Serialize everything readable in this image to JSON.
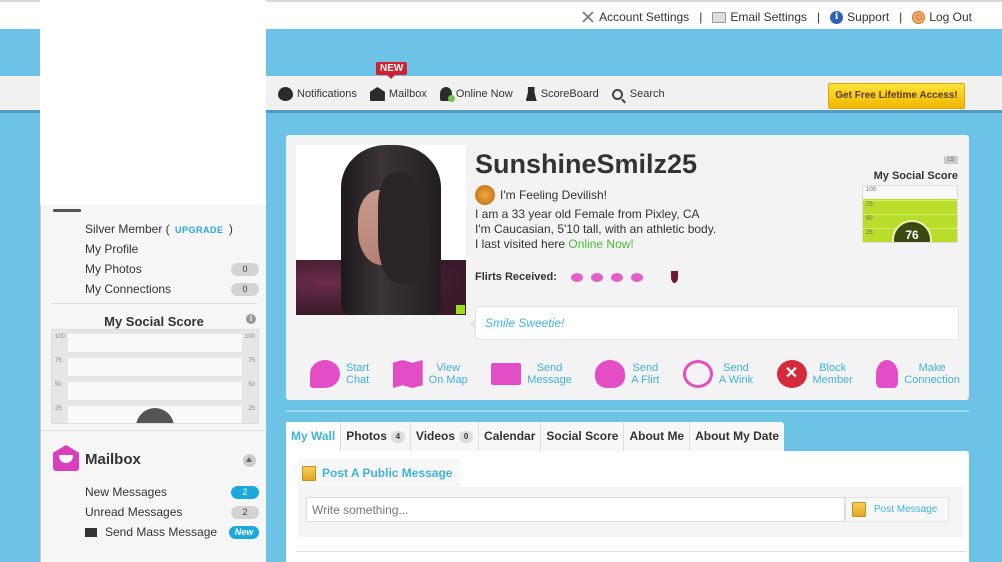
{
  "top_links": {
    "account_settings": "Account Settings",
    "email_settings": "Email Settings",
    "support": "Support",
    "log_out": "Log Out",
    "separator": "|"
  },
  "nav": {
    "new_badge": "NEW",
    "items": [
      {
        "label": "Notifications",
        "icon": "speech-bubble-icon"
      },
      {
        "label": "Mailbox",
        "icon": "envelope-icon"
      },
      {
        "label": "Online Now",
        "icon": "person-online-icon"
      },
      {
        "label": "ScoreBoard",
        "icon": "trophy-icon"
      },
      {
        "label": "Search",
        "icon": "search-icon"
      }
    ],
    "cta": "Get Free Lifetime Access!"
  },
  "sidebar": {
    "membership": "Silver Member (",
    "upgrade": "UPGRADE",
    "membership_close": ")",
    "links": [
      {
        "label": "My Profile"
      },
      {
        "label": "My Photos",
        "count": "0"
      },
      {
        "label": "My Connections",
        "count": "0"
      }
    ],
    "social_score": {
      "title": "My Social Score",
      "ticks": [
        "100",
        "75",
        "50",
        "25"
      ]
    },
    "mailbox": {
      "title": "Mailbox",
      "items": [
        {
          "label": "New Messages",
          "count": "2"
        },
        {
          "label": "Unread Messages",
          "count": "2"
        },
        {
          "label": "Send Mass Message",
          "badge": "New"
        }
      ]
    }
  },
  "profile": {
    "username": "SunshineSmilz25",
    "mood": "I'm Feeling Devilish!",
    "about_line1": "I am a 33 year old Female from Pixley, CA",
    "about_line2": "I'm Caucasian, 5'10 tall, with an athletic body.",
    "about_line3_prefix": "I last visited here ",
    "about_line3_status": "Online Now!",
    "flirts_label": "Flirts Received:",
    "status_message": "Smile Sweetie!",
    "social_score": {
      "badge": "LS",
      "title": "My Social Score",
      "value": "76",
      "percent": 76,
      "ticks": [
        "100",
        "75",
        "50",
        "25"
      ]
    },
    "actions": [
      {
        "line1": "Start",
        "line2": "Chat",
        "icon": "chat-bubble-icon"
      },
      {
        "line1": "View",
        "line2": "On Map",
        "icon": "map-icon"
      },
      {
        "line1": "Send",
        "line2": "Message",
        "icon": "send-message-icon"
      },
      {
        "line1": "Send",
        "line2": "A Flirt",
        "icon": "hearts-icon"
      },
      {
        "line1": "Send",
        "line2": "A Wink",
        "icon": "wink-face-icon"
      },
      {
        "line1": "Block",
        "line2": "Member",
        "icon": "block-x-icon"
      },
      {
        "line1": "Make",
        "line2": "Connection",
        "icon": "add-connection-icon"
      }
    ]
  },
  "tabs": [
    {
      "label": "My Wall",
      "active": true
    },
    {
      "label": "Photos",
      "count": "4"
    },
    {
      "label": "Videos",
      "count": "0"
    },
    {
      "label": "Calendar"
    },
    {
      "label": "Social Score"
    },
    {
      "label": "About Me"
    },
    {
      "label": "About My Date"
    }
  ],
  "wall": {
    "post_title": "Post A Public Message",
    "input_placeholder": "Write something...",
    "post_button": "Post Message"
  }
}
